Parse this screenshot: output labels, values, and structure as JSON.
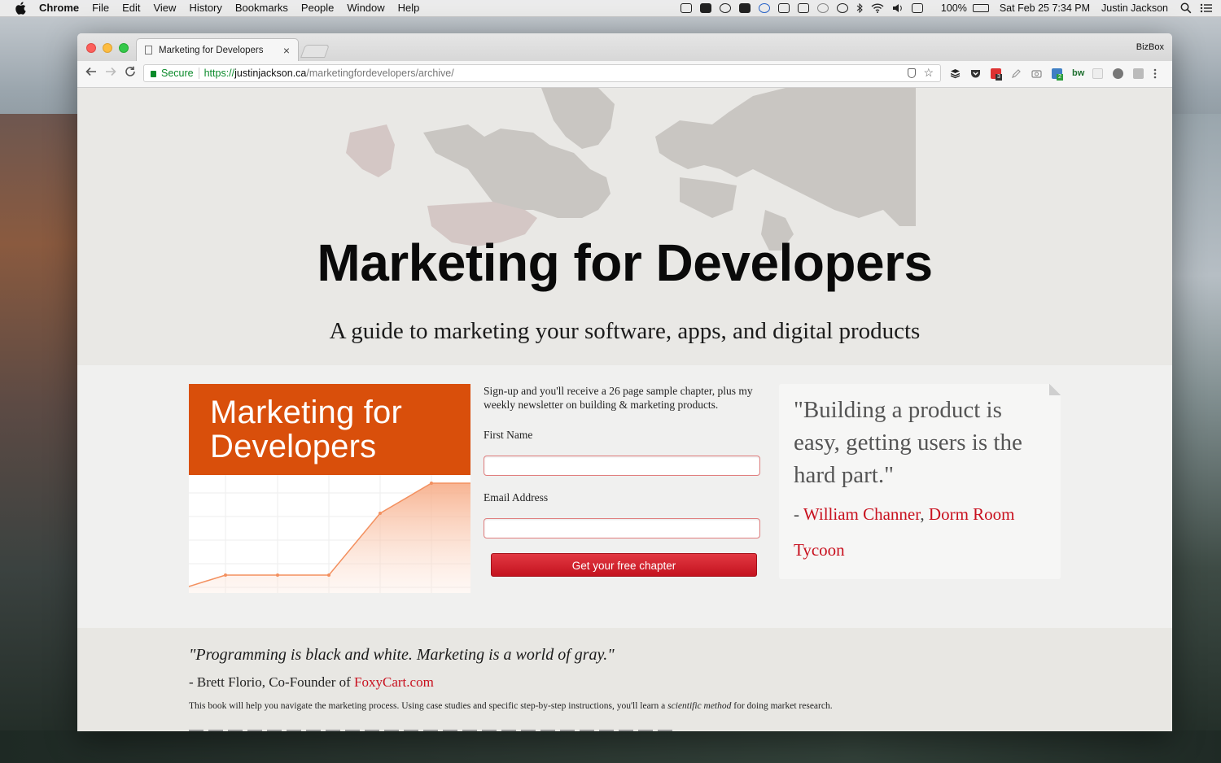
{
  "menubar": {
    "app": "Chrome",
    "items": [
      "File",
      "Edit",
      "View",
      "History",
      "Bookmarks",
      "People",
      "Window",
      "Help"
    ],
    "battery": "100%",
    "datetime": "Sat Feb 25  7:34 PM",
    "user": "Justin Jackson"
  },
  "browser": {
    "tab_title": "Marketing for Developers",
    "tab_close": "×",
    "profile": "BizBox",
    "secure_label": "Secure",
    "url_scheme": "https://",
    "url_host": "justinjackson.ca",
    "url_path": "/marketingfordevelopers/archive/",
    "ext_badge_1": "3",
    "ext_badge_2": "2",
    "ext_label": "bw"
  },
  "hero": {
    "title": "Marketing for Developers",
    "subtitle": "A guide to marketing your software, apps, and digital products"
  },
  "cover": {
    "title_line1": "Marketing for",
    "title_line2": "Developers"
  },
  "signup": {
    "intro": "Sign-up and you'll receive a 26 page sample chapter, plus my weekly newsletter on building & marketing products.",
    "first_name_label": "First Name",
    "first_name_value": "",
    "email_label": "Email Address",
    "email_value": "",
    "button_label": "Get your free chapter"
  },
  "quote": {
    "text": "\"Building a product is easy, getting users is the hard part.\"",
    "dash": "- ",
    "author": "William Channer",
    "comma": ", ",
    "source": "Dorm Room Tycoon"
  },
  "lower": {
    "quote": "\"Programming is black and white. Marketing is a world of gray.\"",
    "by_prefix": "- Brett Florio, Co-Founder of ",
    "by_link": "FoxyCart.com",
    "body_before": "This book will help you navigate the marketing process. Using case studies and specific step-by-step instructions, you'll learn a ",
    "body_em": "scientific method",
    "body_after": " for doing market research."
  },
  "colors": {
    "accent_red": "#c8101e",
    "cover_orange": "#d94f0b",
    "secure_green": "#0a8a2a"
  }
}
